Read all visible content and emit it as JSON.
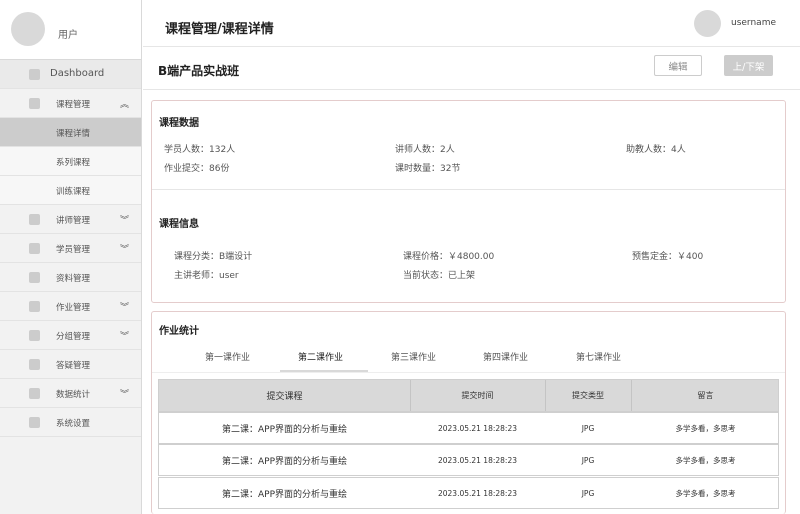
{
  "sidebar": {
    "user_label": "用户",
    "items": [
      {
        "label": "Dashboard"
      },
      {
        "label": "课程管理",
        "chevron": "⯭"
      },
      {
        "label": "课程详情"
      },
      {
        "label": "系列课程"
      },
      {
        "label": "训练课程"
      },
      {
        "label": "讲师管理",
        "chevron": "⯯"
      },
      {
        "label": "学员管理",
        "chevron": "⯯"
      },
      {
        "label": "资料管理"
      },
      {
        "label": "作业管理",
        "chevron": "⯯"
      },
      {
        "label": "分组管理",
        "chevron": "⯯"
      },
      {
        "label": "答疑管理"
      },
      {
        "label": "数据统计",
        "chevron": "⯯"
      },
      {
        "label": "系统设置"
      }
    ]
  },
  "header": {
    "breadcrumb": "课程管理/课程详情",
    "username": "username"
  },
  "course": {
    "title": "B端产品实战班",
    "edit_label": "编辑",
    "toggle_label": "上/下架"
  },
  "course_data": {
    "heading": "课程数据",
    "students": "学员人数：132人",
    "lecturers": "讲师人数：2人",
    "assistants": "助教人数：4人",
    "homework_submitted": "作业提交：86份",
    "lessons": "课时数量：32节"
  },
  "course_info": {
    "heading": "课程信息",
    "category": "课程分类：B端设计",
    "price": "课程价格：￥4800.00",
    "deposit": "预售定金：￥400",
    "teacher": "主讲老师：user",
    "status": "当前状态：已上架"
  },
  "homework": {
    "heading": "作业统计",
    "tabs": [
      "第一课作业",
      "第二课作业",
      "第三课作业",
      "第四课作业",
      "第七课作业"
    ],
    "columns": [
      "提交课程",
      "提交时间",
      "提交类型",
      "留言"
    ],
    "rows": [
      [
        "第二课：APP界面的分析与重绘",
        "2023.05.21 18:28:23",
        "JPG",
        "多学多看，多思考"
      ],
      [
        "第二课：APP界面的分析与重绘",
        "2023.05.21 18:28:23",
        "JPG",
        "多学多看，多思考"
      ],
      [
        "第二课：APP界面的分析与重绘",
        "2023.05.21 18:28:23",
        "JPG",
        "多学多看，多思考"
      ]
    ]
  }
}
